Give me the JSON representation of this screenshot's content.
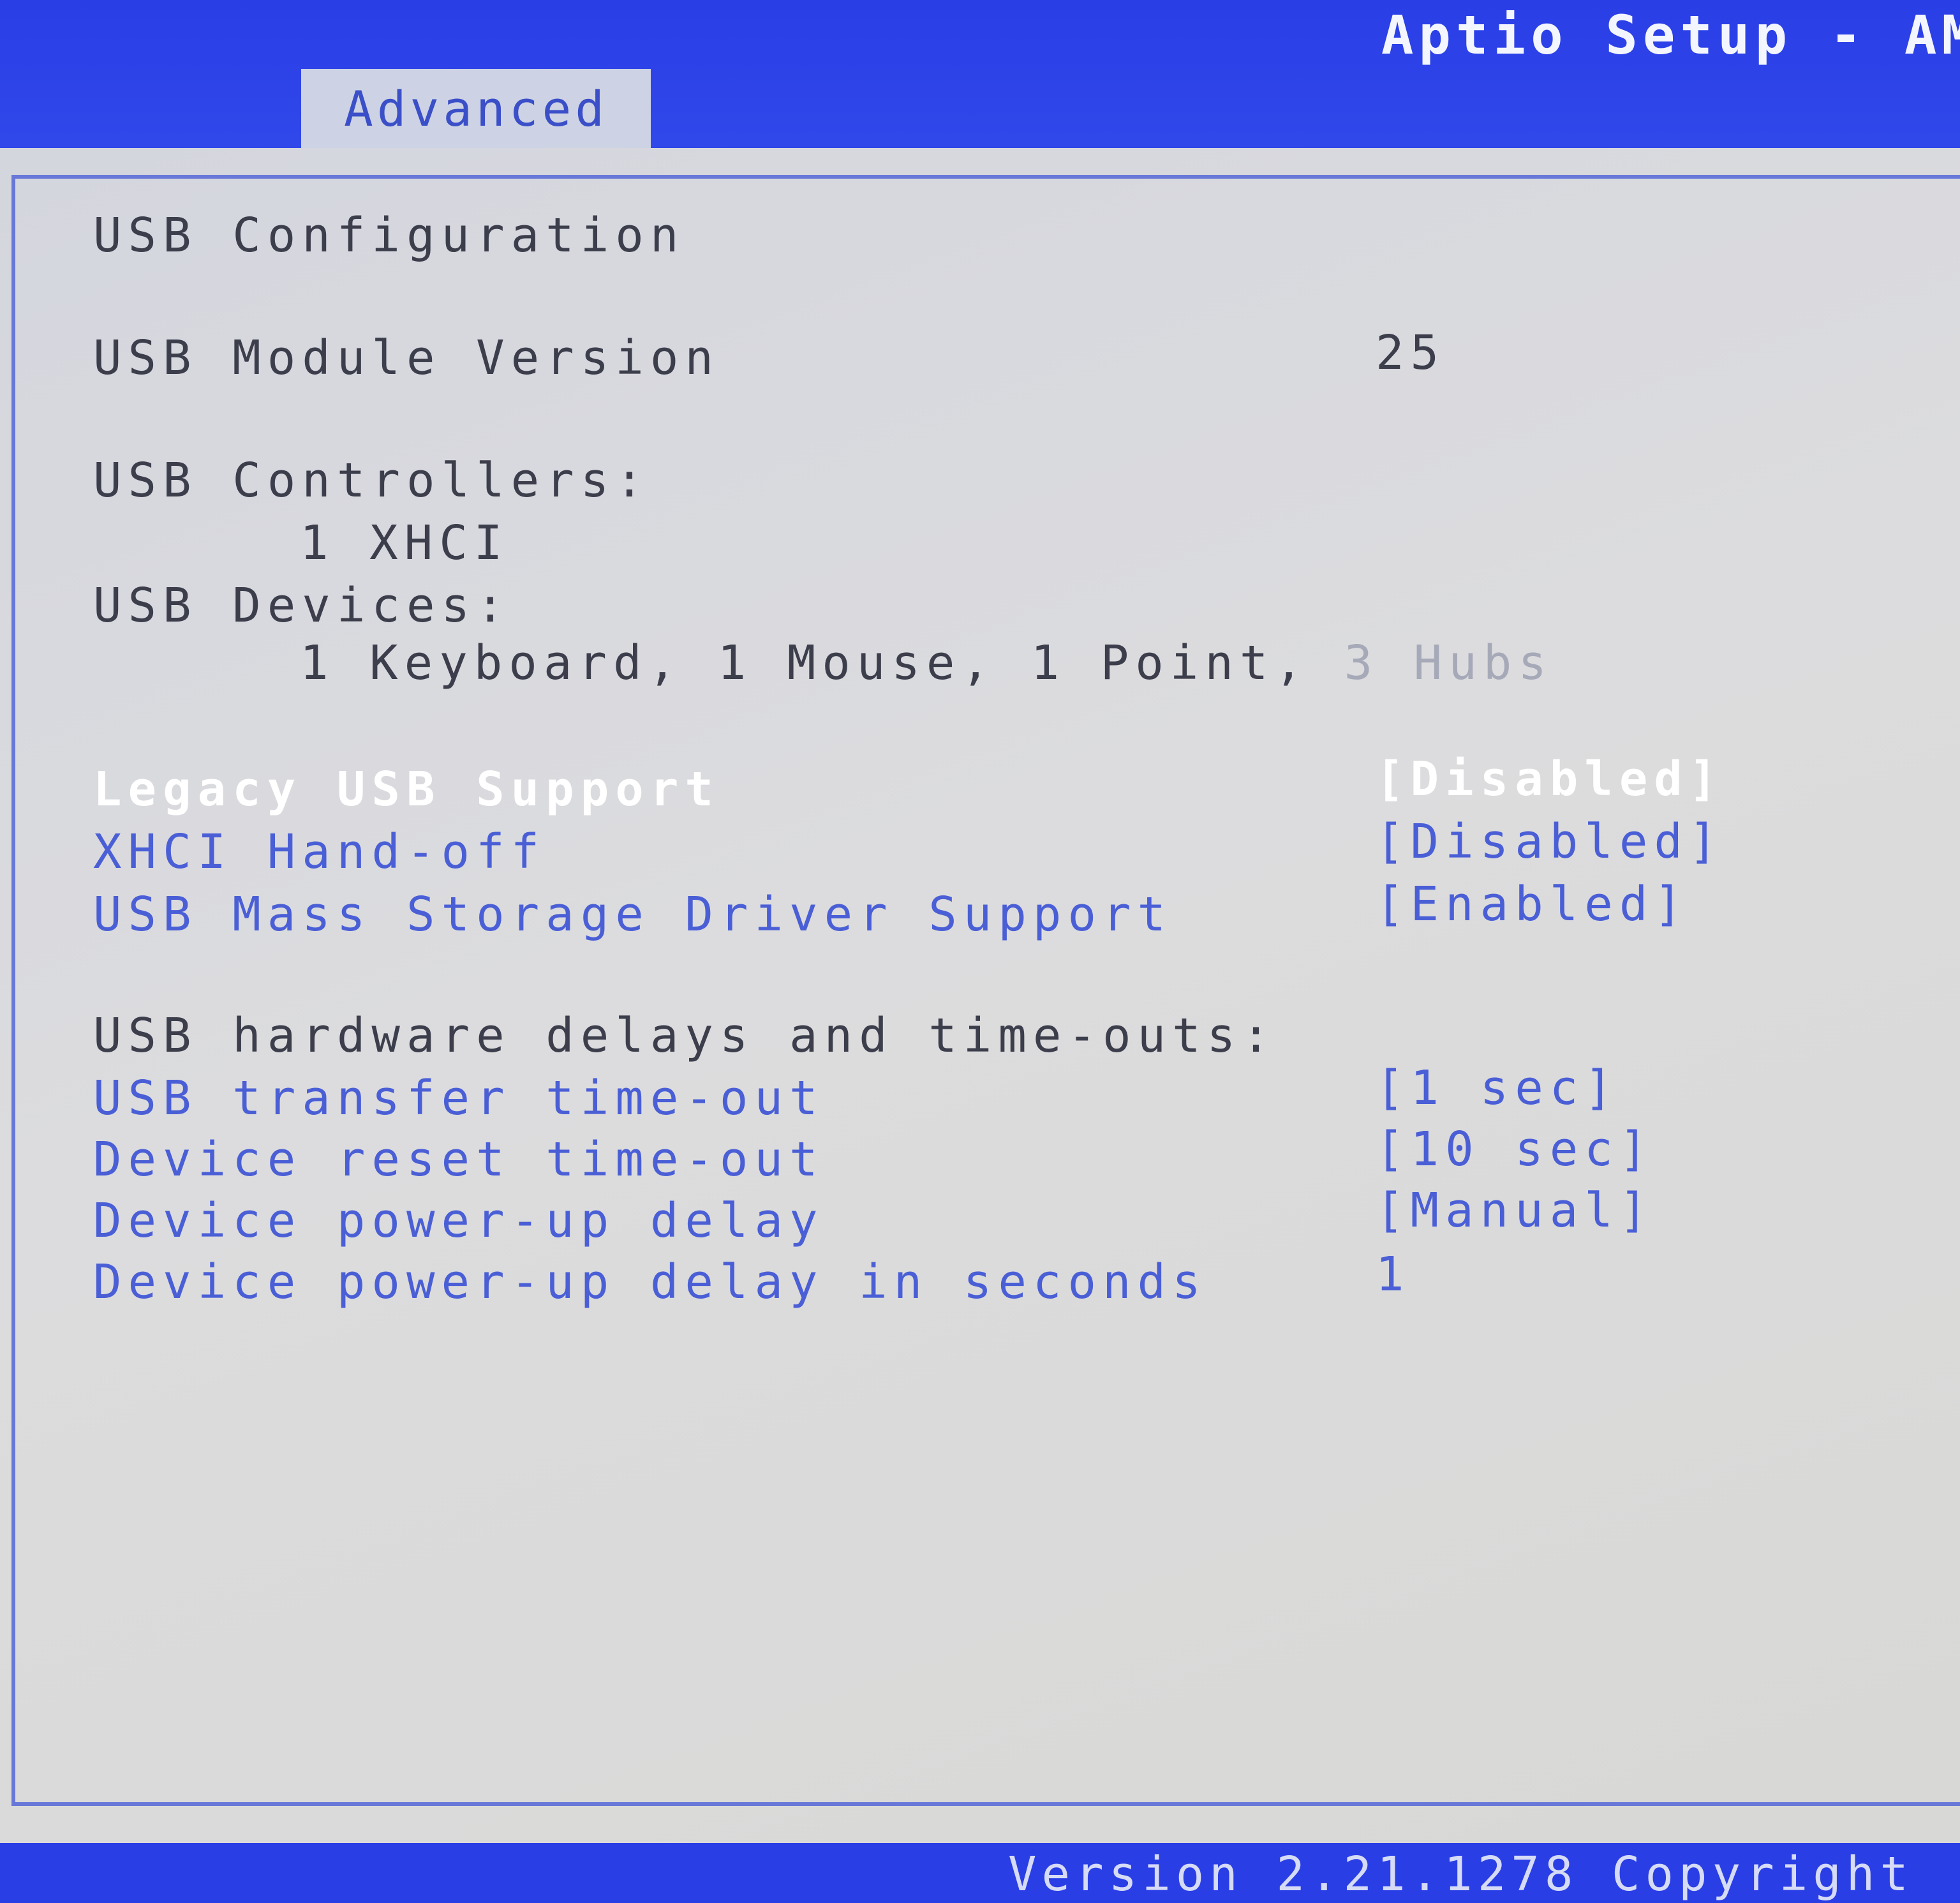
{
  "header": {
    "app_title": "Aptio Setup - AM",
    "active_tab": "Advanced"
  },
  "page": {
    "title": "USB Configuration",
    "module_version_label": "USB Module Version",
    "module_version_value": "25",
    "controllers_label": "USB Controllers:",
    "controllers_value": "1 XHCI",
    "devices_label": "USB Devices:",
    "devices_value_main": "1 Keyboard, 1 Mouse, 1 Point,",
    "devices_value_faded": "3 Hubs"
  },
  "settings": [
    {
      "label": "Legacy USB Support",
      "value": "[Disabled]",
      "selected": true
    },
    {
      "label": "XHCI Hand-off",
      "value": "[Disabled]"
    },
    {
      "label": "USB Mass Storage Driver Support",
      "value": "[Enabled]"
    }
  ],
  "delays_header": "USB hardware delays and time-outs:",
  "delays": [
    {
      "label": "USB transfer time-out",
      "value": "[1 sec]"
    },
    {
      "label": "Device reset time-out",
      "value": "[10 sec]"
    },
    {
      "label": "Device power-up delay",
      "value": "[Manual]"
    },
    {
      "label": "Device power-up delay in seconds",
      "value": "1"
    }
  ],
  "footer": {
    "version_text": "Version 2.21.1278 Copyright"
  },
  "colors": {
    "bios_blue": "#2a3ee6",
    "panel_gray": "#d8d8dc",
    "link_blue": "#4a5fd6",
    "selected_white": "#ffffff"
  }
}
